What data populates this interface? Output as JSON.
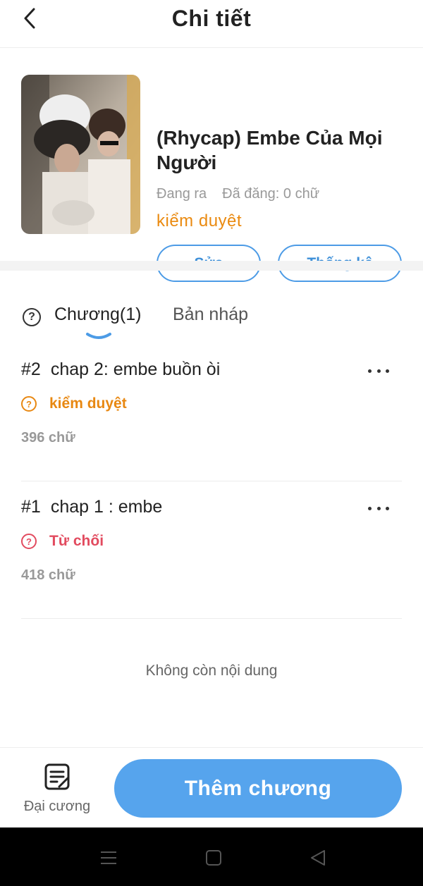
{
  "header": {
    "title": "Chi tiết",
    "back_icon": "chevron-left-icon"
  },
  "story": {
    "title": "(Rhycap) Embe Của Mọi Người",
    "status_text": "Đang ra",
    "posted_text": "Đã đăng: 0 chữ",
    "review_status": "kiểm duyệt",
    "edit_label": "Sửa",
    "stats_label": "Thống kê"
  },
  "tabs": {
    "help_icon": "question-circle-icon",
    "chapters_label": "Chương(1)",
    "drafts_label": "Bản nháp"
  },
  "chapters": [
    {
      "number": "#2",
      "title": "chap 2: embe buồn òi",
      "status": "kiểm duyệt",
      "words": "396 chữ"
    },
    {
      "number": "#1",
      "title": "chap 1 : embe",
      "status": "Từ chối",
      "words": "418 chữ"
    }
  ],
  "end_text": "Không còn nội dung",
  "bottom": {
    "outline_label": "Đại cương",
    "add_chapter_label": "Thêm chương"
  },
  "colors": {
    "accent": "#56a4ed",
    "review": "#e88812",
    "reject": "#e24b5f"
  }
}
